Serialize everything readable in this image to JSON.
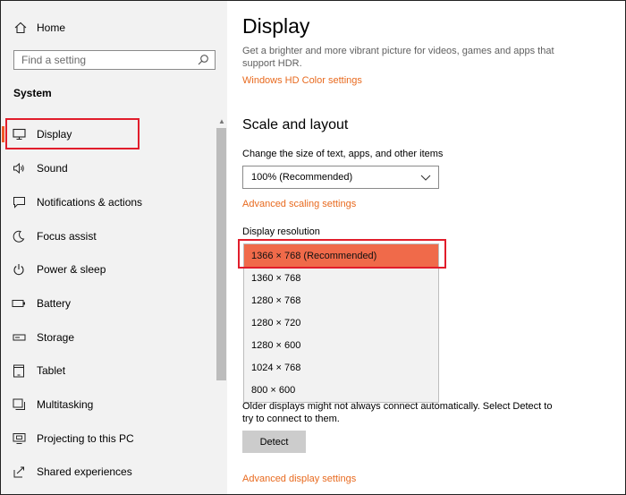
{
  "sidebar": {
    "home_label": "Home",
    "search_placeholder": "Find a setting",
    "section_title": "System",
    "items": [
      {
        "label": "Display",
        "icon": "monitor-icon"
      },
      {
        "label": "Sound",
        "icon": "speaker-icon"
      },
      {
        "label": "Notifications & actions",
        "icon": "notification-icon"
      },
      {
        "label": "Focus assist",
        "icon": "moon-icon"
      },
      {
        "label": "Power & sleep",
        "icon": "power-icon"
      },
      {
        "label": "Battery",
        "icon": "battery-icon"
      },
      {
        "label": "Storage",
        "icon": "storage-icon"
      },
      {
        "label": "Tablet",
        "icon": "tablet-icon"
      },
      {
        "label": "Multitasking",
        "icon": "multitasking-icon"
      },
      {
        "label": "Projecting to this PC",
        "icon": "projector-icon"
      },
      {
        "label": "Shared experiences",
        "icon": "shared-icon"
      }
    ]
  },
  "main": {
    "title": "Display",
    "hdr_description": "Get a brighter and more vibrant picture for videos, games and apps that support HDR.",
    "hd_color_link": "Windows HD Color settings",
    "scale_heading": "Scale and layout",
    "scale_label": "Change the size of text, apps, and other items",
    "scale_value": "100% (Recommended)",
    "advanced_scaling_link": "Advanced scaling settings",
    "resolution_label": "Display resolution",
    "resolution_options": [
      "1366 × 768 (Recommended)",
      "1360 × 768",
      "1280 × 768",
      "1280 × 720",
      "1280 × 600",
      "1024 × 768",
      "800 × 600"
    ],
    "selected_resolution_index": 0,
    "older_displays_text": "Older displays might not always connect automatically. Select Detect to try to connect to them.",
    "detect_button": "Detect",
    "advanced_display_link": "Advanced display settings"
  },
  "colors": {
    "accent": "#f05a28",
    "link": "#e86a1f",
    "selected_option": "#f06a4a",
    "highlight_box": "#e11d2b",
    "sidebar_bg": "#f2f2f2"
  }
}
